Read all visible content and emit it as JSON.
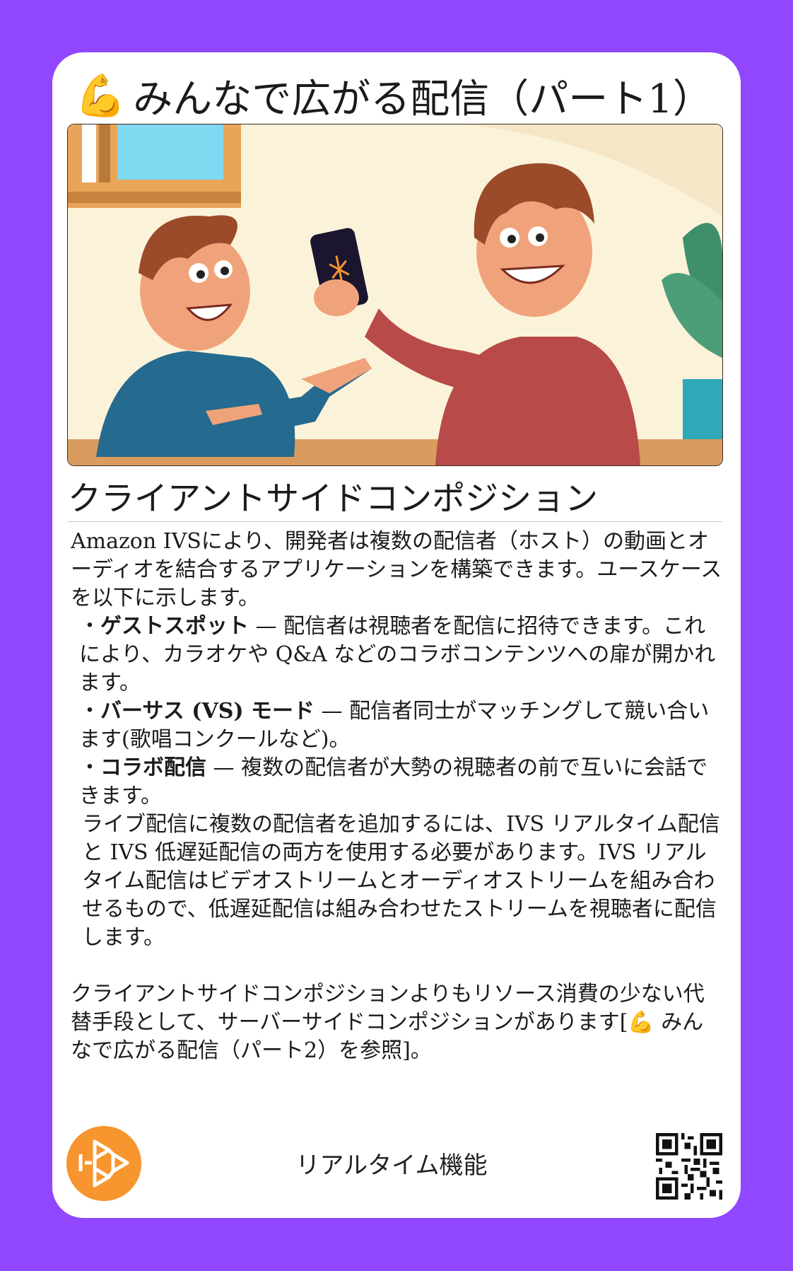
{
  "card": {
    "title_emoji": "💪",
    "title": "みんなで広がる配信（パート1）",
    "subtitle": "クライアントサイドコンポジション",
    "intro": "Amazon IVSにより、開発者は複数の配信者（ホスト）の動画とオーディオを結合するアプリケーションを構築できます。ユースケースを以下に示します。",
    "use_cases": [
      {
        "name": "ゲストスポット",
        "desc": " — 配信者は視聴者を配信に招待できます。これにより、カラオケや Q&A などのコラボコンテンツへの扉が開かれます。"
      },
      {
        "name": "バーサス (VS) モード",
        "desc": " — 配信者同士がマッチングして競い合います(歌唱コンクールなど)。"
      },
      {
        "name": "コラボ配信",
        "desc": " — 複数の配信者が大勢の視聴者の前で互いに会話できます。"
      }
    ],
    "requirement": "ライブ配信に複数の配信者を追加するには、IVS リアルタイム配信と IVS 低遅延配信の両方を使用する必要があります。IVS リアルタイム配信はビデオストリームとオーディオストリームを組み合わせるもので、低遅延配信は組み合わせたストリームを視聴者に配信します。",
    "alternative": "クライアントサイドコンポジションよりもリソース消費の少ない代替手段として、サーバーサイドコンポジションがあります[💪 みんなで広がる配信（パート2）を参照]。",
    "footer_label": "リアルタイム機能"
  },
  "colors": {
    "background": "#9147ff",
    "card": "#ffffff",
    "logo": "#f7952e"
  },
  "icons": {
    "logo": "ivs-logo-icon",
    "qr": "qr-code-icon",
    "title": "flexed-biceps-emoji"
  }
}
